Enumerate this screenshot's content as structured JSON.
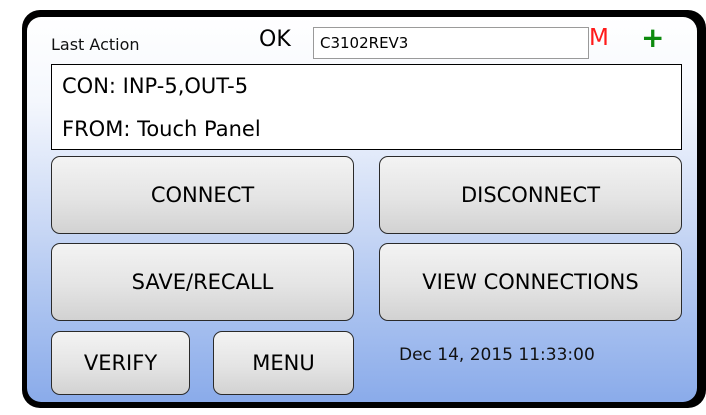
{
  "header": {
    "last_action_label": "Last Action",
    "status_text": "OK",
    "device_name": "C3102REV3",
    "m_indicator": "M",
    "plus_indicator": "+"
  },
  "action_display": {
    "line1": "CON: INP-5,OUT-5",
    "line2": "FROM: Touch Panel"
  },
  "buttons": {
    "connect": "CONNECT",
    "disconnect": "DISCONNECT",
    "save_recall": "SAVE/RECALL",
    "view_connections": "VIEW CONNECTIONS",
    "verify": "VERIFY",
    "menu": "MENU"
  },
  "footer": {
    "timestamp": "Dec 14, 2015 11:33:00"
  },
  "colors": {
    "bezel": "#000000",
    "m_indicator": "#ff1a1a",
    "plus_indicator": "#0d8a0d",
    "gradient_bottom": "#8aabea"
  }
}
